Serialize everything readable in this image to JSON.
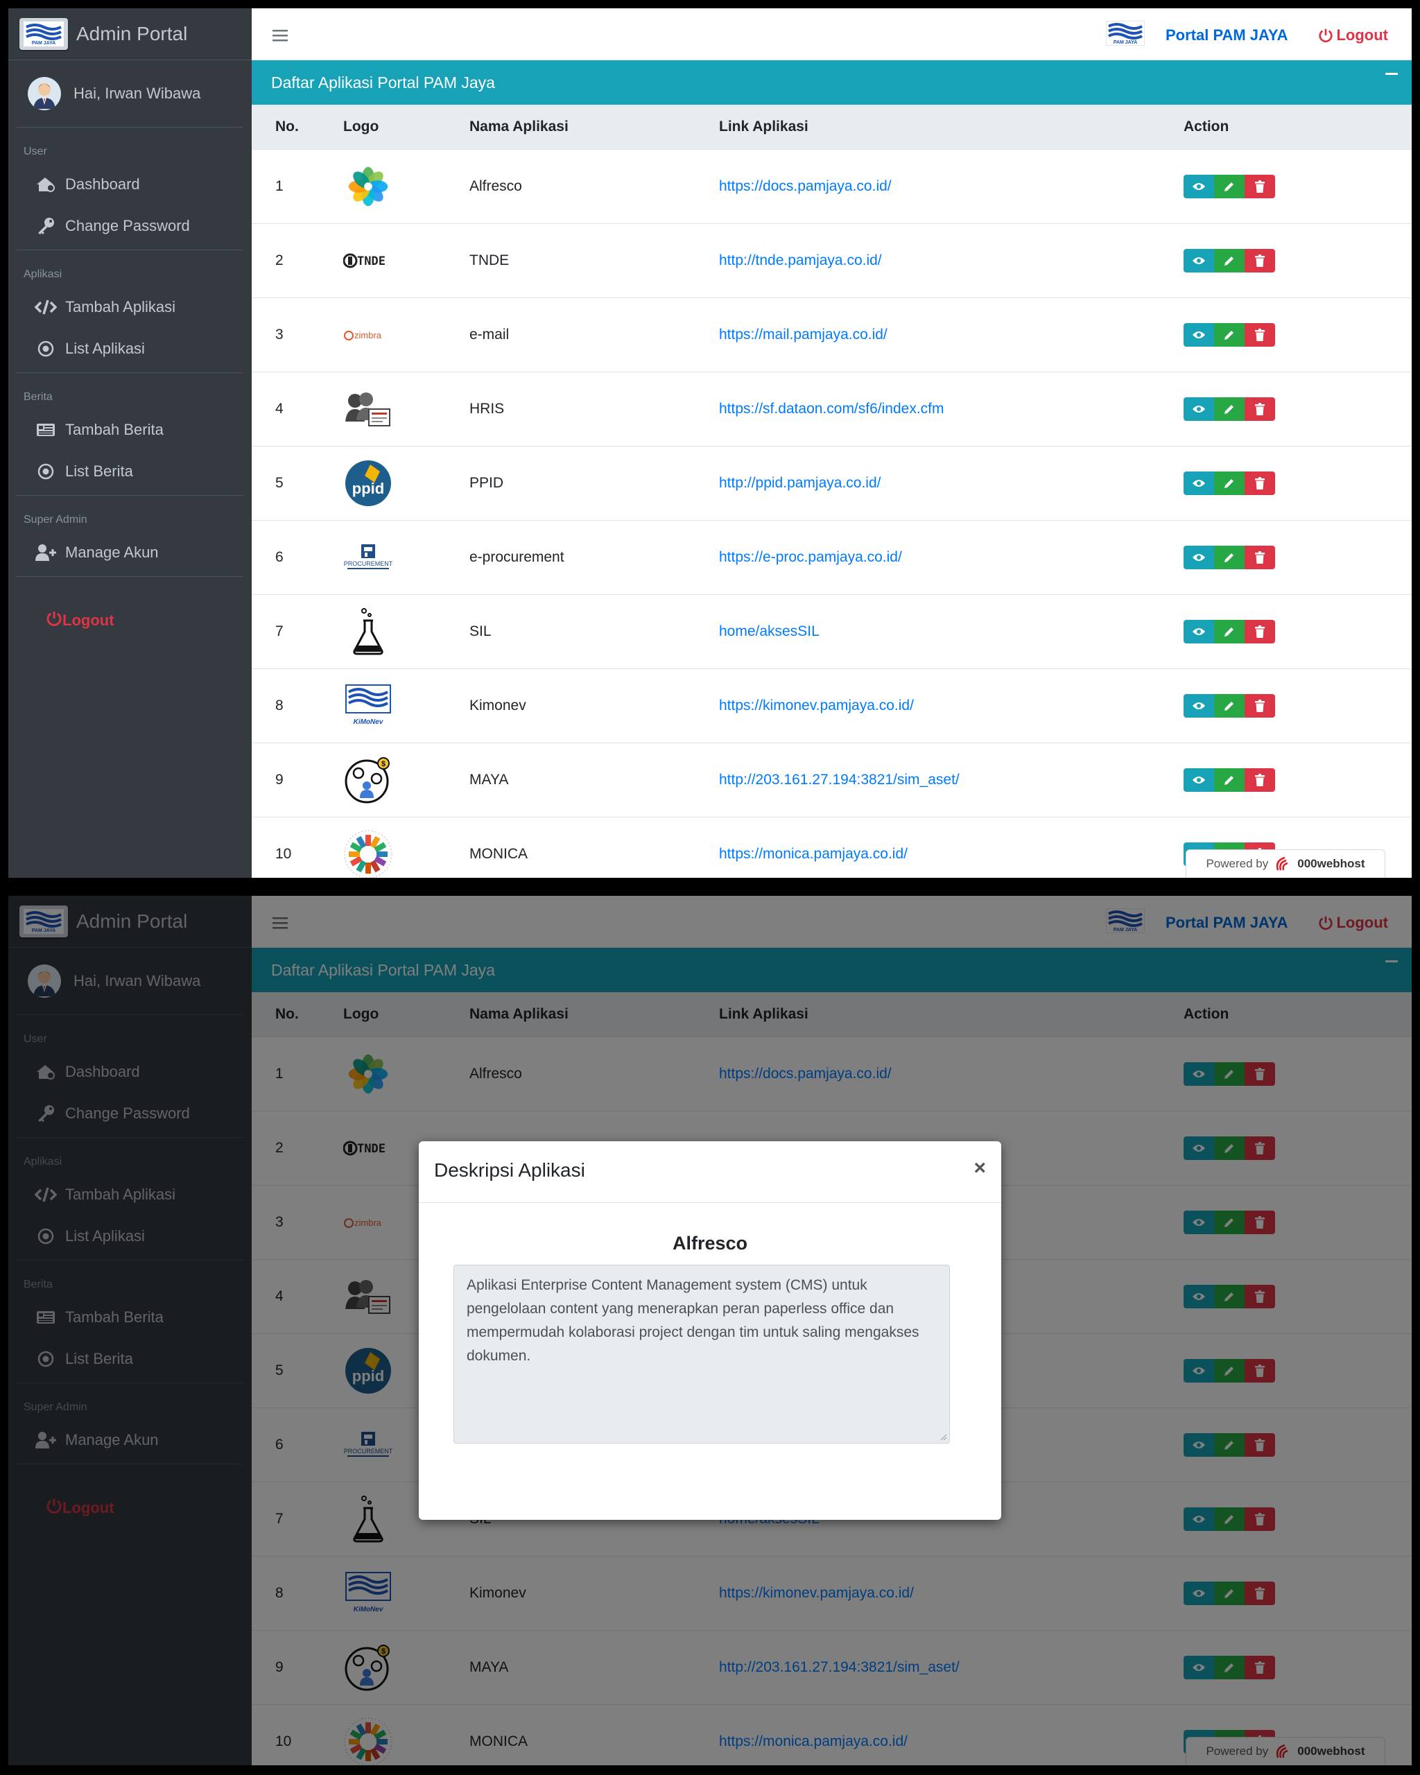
{
  "brand": {
    "title": "Admin Portal",
    "logo_text": "PAM JAYA"
  },
  "user": {
    "greeting": "Hai, Irwan Wibawa"
  },
  "sidebar": {
    "sections": [
      {
        "header": "User",
        "items": [
          {
            "label": "Dashboard",
            "icon": "dashboard-icon"
          },
          {
            "label": "Change Password",
            "icon": "key-icon"
          }
        ]
      },
      {
        "header": "Aplikasi",
        "items": [
          {
            "label": "Tambah Aplikasi",
            "icon": "code-icon"
          },
          {
            "label": "List Aplikasi",
            "icon": "circle-dot-icon"
          }
        ]
      },
      {
        "header": "Berita",
        "items": [
          {
            "label": "Tambah Berita",
            "icon": "news-icon"
          },
          {
            "label": "List Berita",
            "icon": "circle-dot-icon"
          }
        ]
      },
      {
        "header": "Super Admin",
        "items": [
          {
            "label": "Manage Akun",
            "icon": "user-plus-icon"
          }
        ]
      }
    ],
    "logout_label": "Logout"
  },
  "topbar": {
    "portal_label": "Portal PAM JAYA",
    "logout_label": "Logout",
    "logo_text": "PAM JAYA"
  },
  "card": {
    "title": "Daftar Aplikasi Portal PAM Jaya"
  },
  "table": {
    "headers": {
      "no": "No.",
      "logo": "Logo",
      "name": "Nama Aplikasi",
      "link": "Link Aplikasi",
      "action": "Action"
    },
    "rows": [
      {
        "no": "1",
        "name": "Alfresco",
        "link": "https://docs.pamjaya.co.id/",
        "logo": "alfresco-logo"
      },
      {
        "no": "2",
        "name": "TNDE",
        "link": "http://tnde.pamjaya.co.id/",
        "logo": "tnde-logo",
        "logo_text": "TNDE"
      },
      {
        "no": "3",
        "name": "e-mail",
        "link": "https://mail.pamjaya.co.id/",
        "logo": "zimbra-logo",
        "logo_text": "zimbra"
      },
      {
        "no": "4",
        "name": "HRIS",
        "link": "https://sf.dataon.com/sf6/index.cfm",
        "logo": "hris-logo"
      },
      {
        "no": "5",
        "name": "PPID",
        "link": "http://ppid.pamjaya.co.id/",
        "logo": "ppid-logo",
        "logo_text": "ppid"
      },
      {
        "no": "6",
        "name": "e-procurement",
        "link": "https://e-proc.pamjaya.co.id/",
        "logo": "procurement-logo",
        "logo_text": "PROCUREMENT"
      },
      {
        "no": "7",
        "name": "SIL",
        "link": "home/aksesSIL",
        "logo": "flask-logo"
      },
      {
        "no": "8",
        "name": "Kimonev",
        "link": "https://kimonev.pamjaya.co.id/",
        "logo": "kimonev-logo",
        "logo_text": "KiMoNev"
      },
      {
        "no": "9",
        "name": "MAYA",
        "link": "http://203.161.27.194:3821/sim_aset/",
        "logo": "maya-logo"
      },
      {
        "no": "10",
        "name": "MONICA",
        "link": "https://monica.pamjaya.co.id/",
        "logo": "monica-logo"
      }
    ]
  },
  "powered": {
    "prefix": "Powered by",
    "brand": "000webhost"
  },
  "modal": {
    "title": "Deskripsi Aplikasi",
    "close": "×",
    "app_name": "Alfresco",
    "description": "Aplikasi Enterprise Content Management system (CMS) untuk pengelolaan content yang menerapkan peran paperless office dan mempermudah kolaborasi project dengan tim untuk saling mengakses dokumen."
  },
  "colors": {
    "sidebar": "#343a40",
    "card_header": "#17a2b8",
    "link": "#007bff",
    "view": "#17a2b8",
    "edit": "#28a745",
    "delete": "#dc3545"
  }
}
